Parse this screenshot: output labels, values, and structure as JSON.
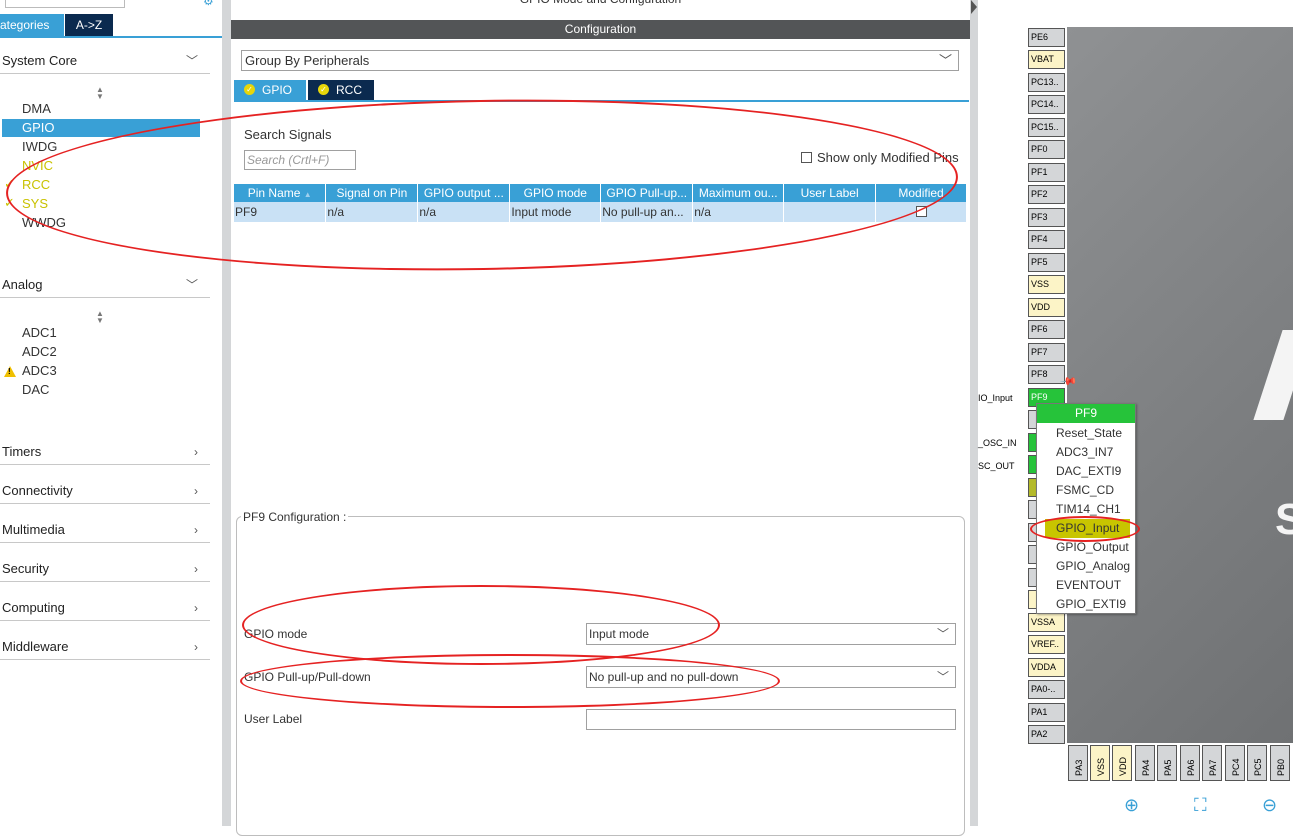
{
  "left": {
    "tab_categories": "ategories",
    "tab_az": "A->Z",
    "system_core": {
      "title": "System Core",
      "items": [
        {
          "label": "DMA",
          "state": "normal"
        },
        {
          "label": "GPIO",
          "state": "selected"
        },
        {
          "label": "IWDG",
          "state": "normal"
        },
        {
          "label": "NVIC",
          "state": "normal-yellow"
        },
        {
          "label": "RCC",
          "state": "ok"
        },
        {
          "label": "SYS",
          "state": "ok"
        },
        {
          "label": "WWDG",
          "state": "normal"
        }
      ]
    },
    "analog": {
      "title": "Analog",
      "items": [
        {
          "label": "ADC1",
          "state": "normal"
        },
        {
          "label": "ADC2",
          "state": "normal"
        },
        {
          "label": "ADC3",
          "state": "warning"
        },
        {
          "label": "DAC",
          "state": "normal"
        }
      ]
    },
    "categories": [
      "Timers",
      "Connectivity",
      "Multimedia",
      "Security",
      "Computing",
      "Middleware"
    ]
  },
  "center": {
    "mode_title": "GPIO Mode and Configuration",
    "config_bar": "Configuration",
    "group_select": "Group By Peripherals",
    "tabs": [
      "GPIO",
      "RCC"
    ],
    "search_label": "Search Signals",
    "search_placeholder": "Search (Crtl+F)",
    "show_modified": "Show only Modified Pins",
    "table": {
      "headers": [
        "Pin Name",
        "Signal on Pin",
        "GPIO output ...",
        "GPIO mode",
        "GPIO Pull-up...",
        "Maximum ou...",
        "User Label",
        "Modified"
      ],
      "rows": [
        [
          "PF9",
          "n/a",
          "n/a",
          "Input mode",
          "No pull-up an...",
          "n/a",
          "",
          ""
        ]
      ]
    },
    "pf9_config": {
      "title": "PF9 Configuration :",
      "gpio_mode_label": "GPIO mode",
      "gpio_mode_value": "Input mode",
      "pull_label": "GPIO Pull-up/Pull-down",
      "pull_value": "No pull-up and no pull-down",
      "user_label_label": "User Label",
      "user_label_value": ""
    }
  },
  "right": {
    "pins_left": [
      "PE6",
      "VBAT",
      "PC13..",
      "PC14..",
      "PC15..",
      "PF0",
      "PF1",
      "PF2",
      "PF3",
      "PF4",
      "PF5",
      "VSS",
      "VDD",
      "PF6",
      "PF7",
      "PF8",
      "PF9"
    ],
    "pins_left_lower": [
      "VSSA",
      "VREF..",
      "VDDA",
      "PA0-..",
      "PA1",
      "PA2"
    ],
    "pins_bottom": [
      "PA3",
      "VSS",
      "VDD",
      "PA4",
      "PA5",
      "PA6",
      "PA7",
      "PC4",
      "PC5",
      "PB0"
    ],
    "side_labels": [
      "IO_Input",
      "_OSC_IN",
      "SC_OUT"
    ],
    "popup": {
      "title": "PF9",
      "items": [
        "Reset_State",
        "ADC3_IN7",
        "DAC_EXTI9",
        "FSMC_CD",
        "TIM14_CH1",
        "GPIO_Input",
        "GPIO_Output",
        "GPIO_Analog",
        "EVENTOUT",
        "GPIO_EXTI9"
      ],
      "highlighted": "GPIO_Input"
    }
  },
  "colors": {
    "accent": "#39a0d6",
    "dark_tab": "#0b2a4f",
    "ok_yellow": "#c9c200",
    "pin_green": "#26c33a",
    "annotation_red": "#e52222"
  }
}
